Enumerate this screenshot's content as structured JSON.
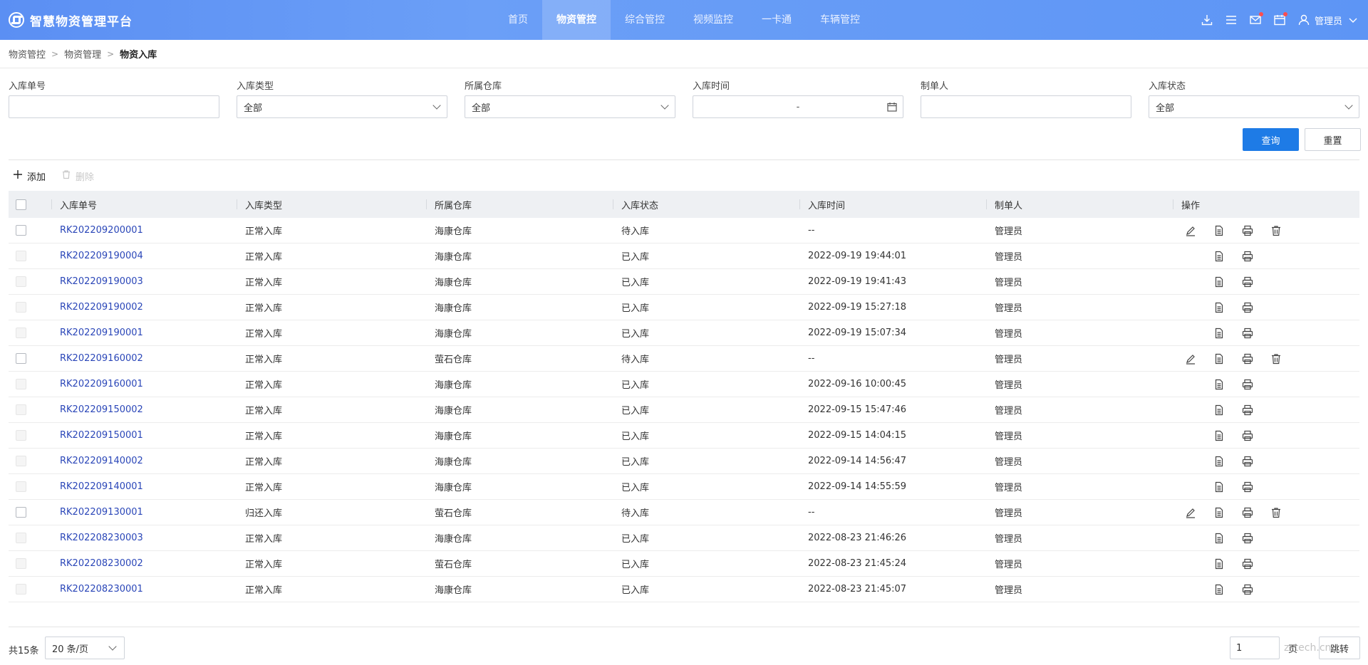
{
  "app": {
    "title": "智慧物资管理平台",
    "nav": [
      "首页",
      "物资管控",
      "综合管控",
      "视频监控",
      "一卡通",
      "车辆管控"
    ],
    "active_nav": 1,
    "user": "管理员"
  },
  "breadcrumb": [
    "物资管控",
    "物资管理",
    "物资入库"
  ],
  "filters": {
    "order_no_label": "入库单号",
    "order_no_value": "",
    "type_label": "入库类型",
    "type_value": "全部",
    "warehouse_label": "所属仓库",
    "warehouse_value": "全部",
    "time_label": "入库时间",
    "time_sep": "-",
    "creator_label": "制单人",
    "creator_value": "",
    "status_label": "入库状态",
    "status_value": "全部",
    "query_label": "查询",
    "reset_label": "重置"
  },
  "toolbar": {
    "add_label": "添加",
    "delete_label": "删除"
  },
  "table": {
    "headers": [
      "入库单号",
      "入库类型",
      "所属仓库",
      "入库状态",
      "入库时间",
      "制单人",
      "操作"
    ],
    "rows": [
      {
        "no": "RK202209200001",
        "type": "正常入库",
        "warehouse": "海康仓库",
        "status": "待入库",
        "time": "--",
        "creator": "管理员",
        "editable": true
      },
      {
        "no": "RK202209190004",
        "type": "正常入库",
        "warehouse": "海康仓库",
        "status": "已入库",
        "time": "2022-09-19 19:44:01",
        "creator": "管理员",
        "editable": false
      },
      {
        "no": "RK202209190003",
        "type": "正常入库",
        "warehouse": "海康仓库",
        "status": "已入库",
        "time": "2022-09-19 19:41:43",
        "creator": "管理员",
        "editable": false
      },
      {
        "no": "RK202209190002",
        "type": "正常入库",
        "warehouse": "海康仓库",
        "status": "已入库",
        "time": "2022-09-19 15:27:18",
        "creator": "管理员",
        "editable": false
      },
      {
        "no": "RK202209190001",
        "type": "正常入库",
        "warehouse": "海康仓库",
        "status": "已入库",
        "time": "2022-09-19 15:07:34",
        "creator": "管理员",
        "editable": false
      },
      {
        "no": "RK202209160002",
        "type": "正常入库",
        "warehouse": "萤石仓库",
        "status": "待入库",
        "time": "--",
        "creator": "管理员",
        "editable": true
      },
      {
        "no": "RK202209160001",
        "type": "正常入库",
        "warehouse": "海康仓库",
        "status": "已入库",
        "time": "2022-09-16 10:00:45",
        "creator": "管理员",
        "editable": false
      },
      {
        "no": "RK202209150002",
        "type": "正常入库",
        "warehouse": "海康仓库",
        "status": "已入库",
        "time": "2022-09-15 15:47:46",
        "creator": "管理员",
        "editable": false
      },
      {
        "no": "RK202209150001",
        "type": "正常入库",
        "warehouse": "海康仓库",
        "status": "已入库",
        "time": "2022-09-15 14:04:15",
        "creator": "管理员",
        "editable": false
      },
      {
        "no": "RK202209140002",
        "type": "正常入库",
        "warehouse": "海康仓库",
        "status": "已入库",
        "time": "2022-09-14 14:56:47",
        "creator": "管理员",
        "editable": false
      },
      {
        "no": "RK202209140001",
        "type": "正常入库",
        "warehouse": "海康仓库",
        "status": "已入库",
        "time": "2022-09-14 14:55:59",
        "creator": "管理员",
        "editable": false
      },
      {
        "no": "RK202209130001",
        "type": "归还入库",
        "warehouse": "萤石仓库",
        "status": "待入库",
        "time": "--",
        "creator": "管理员",
        "editable": true
      },
      {
        "no": "RK202208230003",
        "type": "正常入库",
        "warehouse": "海康仓库",
        "status": "已入库",
        "time": "2022-08-23 21:46:26",
        "creator": "管理员",
        "editable": false
      },
      {
        "no": "RK202208230002",
        "type": "正常入库",
        "warehouse": "萤石仓库",
        "status": "已入库",
        "time": "2022-08-23 21:45:24",
        "creator": "管理员",
        "editable": false
      },
      {
        "no": "RK202208230001",
        "type": "正常入库",
        "warehouse": "海康仓库",
        "status": "已入库",
        "time": "2022-08-23 21:45:07",
        "creator": "管理员",
        "editable": false
      }
    ]
  },
  "pagination": {
    "total_label": "共15条",
    "page_size": "20 条/页",
    "page_input": "1",
    "page_unit": "页",
    "jump_label": "跳转",
    "watermark": "zztech.cn"
  },
  "colors": {
    "topbar": "#5b8ff3",
    "primary": "#1e7be6",
    "link": "#2a46b8"
  }
}
